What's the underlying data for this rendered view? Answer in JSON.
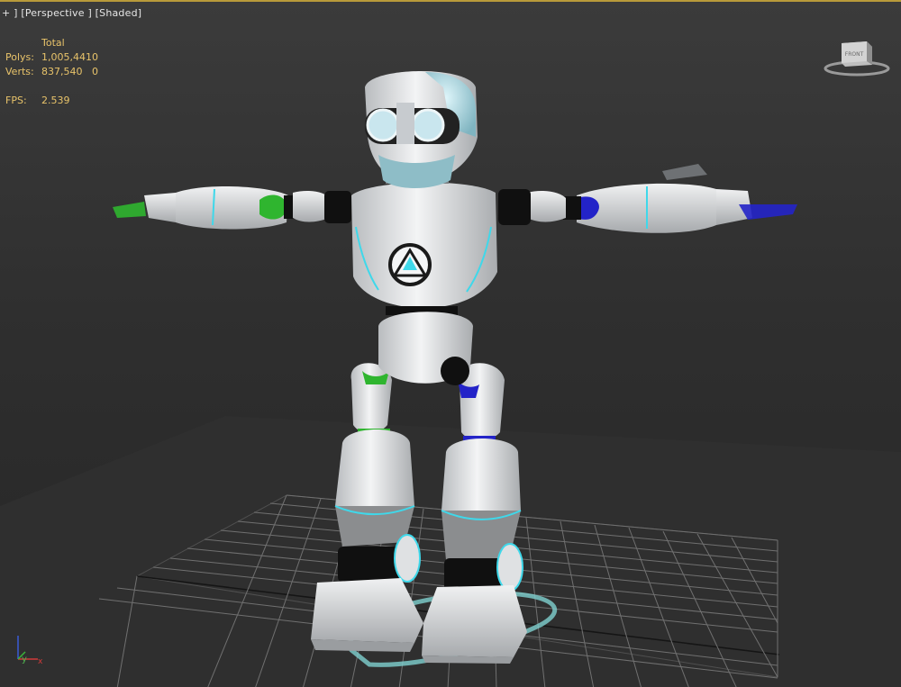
{
  "viewport": {
    "plus": "+",
    "view": "[Perspective",
    "shading": "[Shaded]"
  },
  "stats": {
    "header": "Total",
    "polys_label": "Polys:",
    "polys_value": "1,005,441",
    "polys_sel": "0",
    "verts_label": "Verts:",
    "verts_value": "837,540",
    "verts_sel": "0",
    "fps_label": "FPS:",
    "fps_value": "2.539"
  },
  "viewcube": {
    "face_label": "FRONT"
  },
  "axis": {
    "x": "x",
    "y": "y",
    "z": "z"
  },
  "colors": {
    "accent_border": "#b89a3a",
    "stats_text": "#e8c36a",
    "grid": "#8a8a8a",
    "robot_body": "#e4e6e8",
    "robot_glow": "#3fd8ea",
    "joint_left": "#2fb52f",
    "joint_right": "#2323c8"
  }
}
